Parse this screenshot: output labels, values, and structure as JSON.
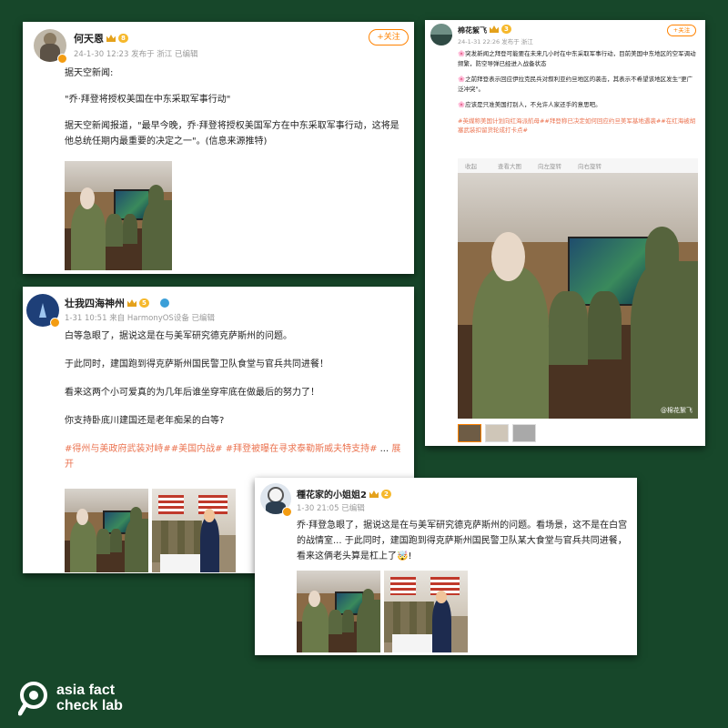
{
  "post1": {
    "username": "何天恩",
    "level": "8",
    "meta": "24-1-30 12:23 发布于 浙江  已编辑",
    "follow": "+关注",
    "lines": [
      "据天空新闻:",
      "\"乔·拜登将授权美国在中东采取军事行动\"",
      "据天空新闻报道，\"最早今晚，乔·拜登将授权美国军方在中东采取军事行动，这将是他总统任期内最重要的决定之一\"。(信息来源推特)"
    ]
  },
  "post2": {
    "username": "棉花絮飞",
    "level": "3",
    "meta": "24-1-31 22:26 发布于 浙江",
    "follow": "+关注",
    "lines": [
      "🌸突发新闻之拜登可能要在未来几小时在中东采取军事行动，目前美国中东地区的空军调动频繁，防空导弹已经进入战备状态",
      "🌸之前拜登表示回应伊拉克民兵对叙利亚约旦地区的袭击，其表示不希望该地区发生\"更广泛冲突\"。",
      "🌸应该是只准美国打别人，不允许人家还手的意思吧。"
    ],
    "tags": "#英媒称美国计划向红海派航母##拜登称已决定如何回应约旦美军基地遇袭##在红海被胡塞武装扣留货轮成打卡点#",
    "actions": [
      "收起",
      "查看大图",
      "向左旋转",
      "向右旋转"
    ],
    "watermark": "@棉花絮飞"
  },
  "post3": {
    "username": "壮我四海神州",
    "level": "5",
    "meta": "1-31 10:51 来自 HarmonyOS设备  已编辑",
    "lines": [
      "白等急眼了，据说这是在与美军研究德克萨斯州的问题。",
      "于此同时，建国跑到得克萨斯州国民警卫队食堂与官兵共同进餐！",
      "看来这两个小可爱真的为几年后谁坐穿牢底在做最后的努力了！",
      "你支持卧底川建国还是老年痴呆的白等?"
    ],
    "tags": "#得州与美政府武装对峙##美国内战# #拜登被曝在寻求泰勒斯威夫特支持#",
    "expand_prefix": " ... ",
    "expand": "展开"
  },
  "post4": {
    "username": "種花家的小姐姐2",
    "level": "2",
    "meta": "1-30 21:05  已编辑",
    "text": "乔·拜登急眼了，据说这是在与美军研究德克萨斯州的问题。看场景，这不是在白宫的战情室... 于此同时，建国跑到得克萨斯州国民警卫队某大食堂与官兵共同进餐，看来这俩老头算是杠上了🤯!"
  },
  "logo": {
    "line1": "asia fact",
    "line2": "check lab"
  }
}
